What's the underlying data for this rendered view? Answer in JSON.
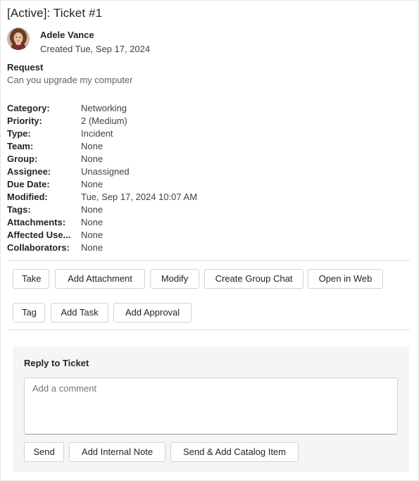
{
  "ticket": {
    "title": "[Active]: Ticket #1",
    "requester_name": "Adele Vance",
    "created": "Created Tue, Sep 17, 2024"
  },
  "request": {
    "label": "Request",
    "text": "Can you upgrade my computer"
  },
  "fields": [
    {
      "label": "Category:",
      "value": "Networking"
    },
    {
      "label": "Priority:",
      "value": "2 (Medium)"
    },
    {
      "label": "Type:",
      "value": "Incident"
    },
    {
      "label": "Team:",
      "value": "None"
    },
    {
      "label": "Group:",
      "value": "None"
    },
    {
      "label": "Assignee:",
      "value": "Unassigned"
    },
    {
      "label": "Due Date:",
      "value": "None"
    },
    {
      "label": "Modified:",
      "value": "Tue, Sep 17, 2024 10:07 AM"
    },
    {
      "label": "Tags:",
      "value": "None"
    },
    {
      "label": "Attachments:",
      "value": "None"
    },
    {
      "label": "Affected Use...",
      "value": "None"
    },
    {
      "label": "Collaborators:",
      "value": "None"
    }
  ],
  "actions": {
    "take": "Take",
    "add_attachment": "Add Attachment",
    "modify": "Modify",
    "create_group_chat": "Create Group Chat",
    "open_in_web": "Open in Web",
    "tag": "Tag",
    "add_task": "Add Task",
    "add_approval": "Add Approval"
  },
  "reply": {
    "title": "Reply to Ticket",
    "placeholder": "Add a comment",
    "send": "Send",
    "add_internal_note": "Add Internal Note",
    "send_add_catalog": "Send & Add Catalog Item"
  },
  "colors": {
    "background": "#ffffff",
    "panel": "#f5f5f5",
    "border": "#d1d1d1",
    "text": "#242424"
  }
}
